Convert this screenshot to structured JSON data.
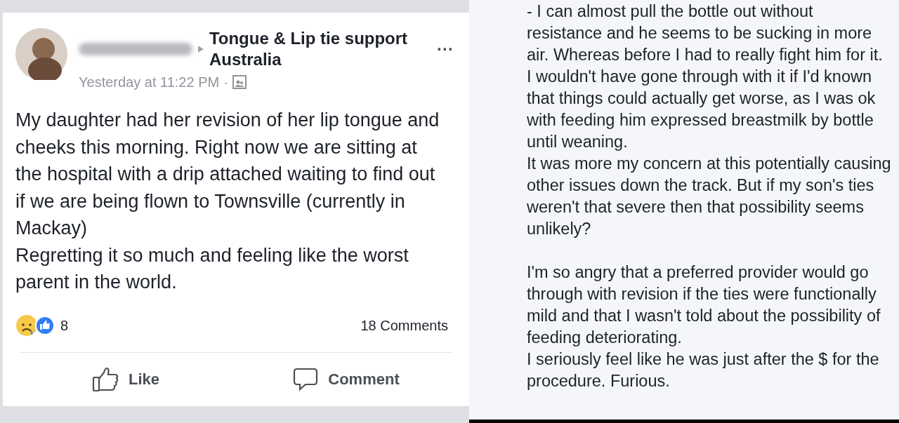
{
  "post": {
    "group": "Tongue & Lip tie support Australia",
    "time": "Yesterday at 11:22 PM",
    "separator": "·",
    "more": "···",
    "body": [
      "My daughter had her revision of her lip tongue and cheeks this morning. Right now we are sitting at the hospital with a drip attached waiting to find out if we are being flown to Townsville (currently in Mackay)",
      "Regretting it so much and feeling like the worst parent in the world."
    ],
    "reaction_count": "8",
    "comments_count": "18 Comments",
    "actions": [
      {
        "kind": "like",
        "label": "Like"
      },
      {
        "kind": "comment",
        "label": "Comment"
      }
    ]
  },
  "comment": {
    "paragraphs": [
      "- I can almost pull the bottle out without resistance and he seems to be sucking in more air. Whereas before I had to really fight him for it.",
      "I wouldn't have gone through with it if I'd known that things could actually get worse, as I was ok with feeding him expressed breastmilk by bottle until weaning.",
      "It was more my concern at this potentially causing other issues down the track. But if my son's ties weren't that severe then that possibility seems unlikely?",
      "I'm so angry that a preferred provider would go through with revision if the ties were functionally mild and that I wasn't told about the possibility of feeding deteriorating.",
      "I seriously feel like he was just after the $ for the procedure. Furious."
    ]
  }
}
